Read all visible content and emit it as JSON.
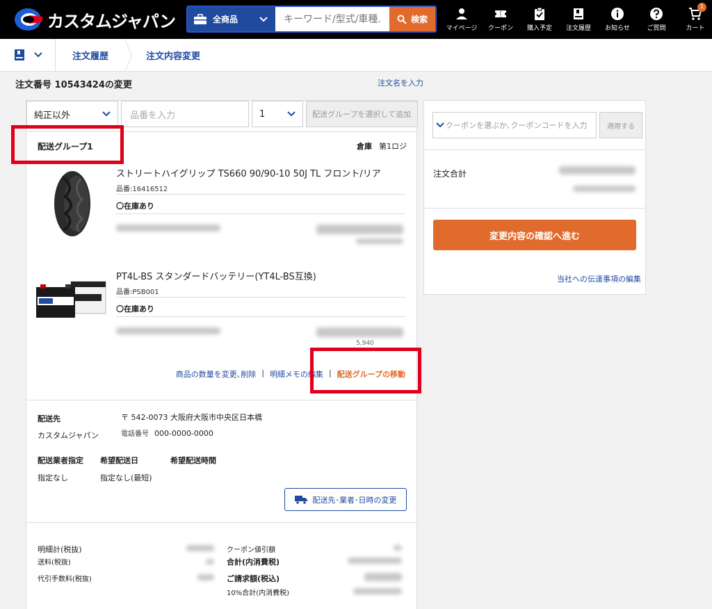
{
  "header": {
    "logo_text": "カスタムジャパン",
    "category": "全商品",
    "search_placeholder": "キーワード/型式/車種...",
    "search_button": "検索",
    "nav": [
      {
        "label": "マイページ",
        "icon": "person-icon"
      },
      {
        "label": "クーポン",
        "icon": "ticket-icon"
      },
      {
        "label": "購入予定",
        "icon": "clipboard-check-icon"
      },
      {
        "label": "注文履歴",
        "icon": "bookmark-icon"
      },
      {
        "label": "お知らせ",
        "icon": "info-icon"
      },
      {
        "label": "ご質問",
        "icon": "help-icon"
      },
      {
        "label": "カート",
        "icon": "cart-icon"
      }
    ],
    "cart_count": "1"
  },
  "breadcrumb": {
    "items": [
      "注文履歴",
      "注文内容変更"
    ]
  },
  "page": {
    "title": "注文番号 10543424の変更",
    "order_name_link": "注文名を入力"
  },
  "filters": {
    "type_select": "純正以外",
    "part_placeholder": "品番を入力",
    "qty_select": "1",
    "add_button": "配送グループを選択して追加"
  },
  "group": {
    "title": "配送グループ1",
    "warehouse_label": "倉庫",
    "warehouse_value": "第1ロジ",
    "products": [
      {
        "name": "ストリートハイグリップ TS660 90/90-10 50J TL フロント/リア",
        "code": "品番:16416512",
        "stock": "〇在庫あり"
      },
      {
        "name": "PT4L-BS スタンダードバッテリー(YT4L-BS互換)",
        "code": "品番:PSB001",
        "stock": "〇在庫あり"
      }
    ],
    "partial_price": "5,940",
    "actions": {
      "change_qty": "商品の数量を変更､削除",
      "memo": "明細メモの編集",
      "move_group": "配送グループの移動"
    }
  },
  "shipping": {
    "dest_label": "配送先",
    "dest_name": "カスタムジャパン",
    "postal": "〒 542-0073 大阪府大阪市中央区日本橋",
    "phone_label": "電話番号",
    "phone": "000-0000-0000",
    "carrier_label": "配送業者指定",
    "date_label": "希望配送日",
    "time_label": "希望配送時間",
    "carrier_value": "指定なし",
    "date_value": "指定なし(最短)",
    "change_button": "配送先･業者･日時の変更"
  },
  "summary": {
    "subtotal": "明細計(税抜)",
    "shipping_fee": "送料(税抜)",
    "cod_fee": "代引手数料(税抜)",
    "coupon_discount": "クーポン値引額",
    "total_tax": "合計(内消費税)",
    "billing": "ご請求額(税込)",
    "tax10": "10%合計(内消費税)"
  },
  "right": {
    "coupon_placeholder": "クーポンを選ぶか､クーポンコードを入力",
    "apply_button": "適用する",
    "total_label": "注文合計",
    "confirm_button": "変更内容の確認へ進む",
    "message_link": "当社への伝達事項の編集"
  },
  "colors": {
    "brand_blue": "#1f4a9e",
    "accent_orange": "#e06b2c",
    "highlight_red": "#e0001b"
  }
}
